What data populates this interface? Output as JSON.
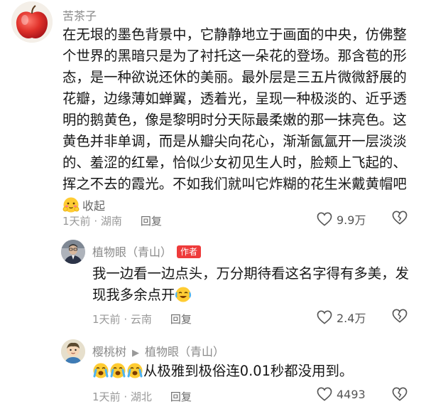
{
  "main_comment": {
    "username": "苦茶子",
    "avatar_icon": "apple-avatar",
    "text": "在无垠的墨色背景中，它静静地立于画面的中央，仿佛整个世界的黑暗只是为了衬托这一朵花的登场。那含苞的形态，是一种欲说还休的美丽。最外层是三五片微微舒展的花瓣，边缘薄如蝉翼，透着光，呈现一种极淡的、近乎透明的鹅黄色，像是黎明时分天际最柔嫩的那一抹亮色。这黄色并非单调，而是从瓣尖向花心，渐渐氤氲开一层淡淡的、羞涩的红晕，恰似少女初见生人时，脸颊上飞起的、挥之不去的霞光。不如我们就叫它炸糊的花生米戴黄帽吧",
    "emoji": "shy-face-emoji",
    "collapse_label": "收起",
    "time": "1天前",
    "location": "湖南",
    "reply_label": "回复",
    "likes": "9.9万"
  },
  "replies": [
    {
      "username": "植物眼（青山）",
      "badge": "作者",
      "avatar_icon": "man-portrait-avatar",
      "text": "我一边看一边点头，万分期待看这名字得有多美，发现我多余点开",
      "emoji": "crying-laugh-emoji",
      "time": "1天前",
      "location": "云南",
      "reply_label": "回复",
      "likes": "2.4万"
    },
    {
      "username": "樱桃树",
      "reply_to": "植物眼（青山）",
      "avatar_icon": "cartoon-avatar",
      "emoji": "loud-crying-emoji",
      "text": "从极雅到极俗连0.01秒都没用到。",
      "time": "1天前",
      "location": "湖北",
      "reply_label": "回复",
      "likes": "4493"
    }
  ],
  "colors": {
    "author_badge": "#ee3b3b",
    "meta_text": "#999999",
    "username": "#8a8a8a"
  }
}
